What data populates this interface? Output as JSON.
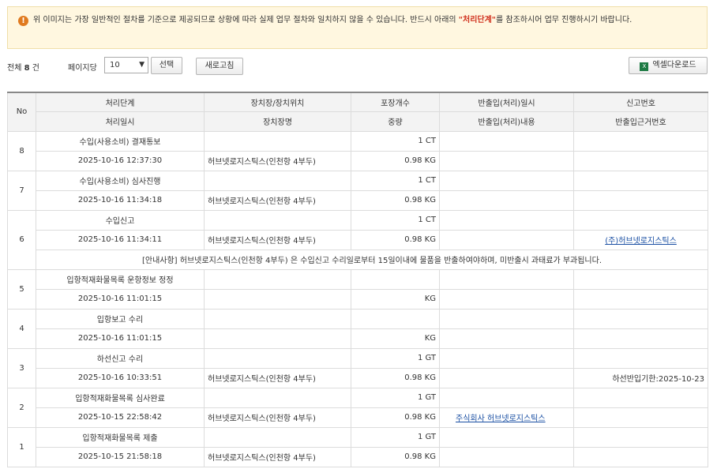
{
  "notice": {
    "icon": "warning-icon",
    "text_before": "위 이미지는 가장 일반적인 절차를 기준으로 제공되므로 상황에 따라 실제 업무 절차와 일치하지 않을 수 있습니다. 반드시 아래의 ",
    "highlight": "\"처리단계\"",
    "text_after": "를 참조하시어 업무 진행하시기 바랍니다."
  },
  "toolbar": {
    "total_prefix": "전체",
    "total_count": "8",
    "total_suffix": "건",
    "perpage_label": "페이지당",
    "perpage_value": "10",
    "select_button": "선택",
    "refresh_button": "새로고침",
    "excel_button": "엑셀다운로드",
    "excel_icon": "excel-icon"
  },
  "table": {
    "headers_top": [
      "No",
      "처리단계",
      "장치장/장치위치",
      "포장개수",
      "반출입(처리)일시",
      "신고번호"
    ],
    "headers_bottom": [
      "처리일시",
      "장치장명",
      "중량",
      "반출입(처리)내용",
      "반출입근거번호"
    ],
    "rows": [
      {
        "no": "8",
        "stage": "수입(사용소비) 결재통보",
        "location": "",
        "packages": "1 CT",
        "io_datetime": "",
        "report_no": "",
        "datetime": "2025-10-16 12:37:30",
        "warehouse": "허브넷로지스틱스(인천항 4부두)",
        "weight": "0.98 KG",
        "io_content": "",
        "basis_no": ""
      },
      {
        "no": "7",
        "stage": "수입(사용소비) 심사진행",
        "location": "",
        "packages": "1 CT",
        "io_datetime": "",
        "report_no": "",
        "datetime": "2025-10-16 11:34:18",
        "warehouse": "허브넷로지스틱스(인천항 4부두)",
        "weight": "0.98 KG",
        "io_content": "",
        "basis_no": ""
      },
      {
        "no": "6",
        "stage": "수입신고",
        "location": "",
        "packages": "1 CT",
        "io_datetime": "",
        "report_no": "",
        "datetime": "2025-10-16 11:34:11",
        "warehouse": "허브넷로지스틱스(인천항 4부두)",
        "weight": "0.98 KG",
        "io_content": "",
        "basis_no": "(주)허브넷로지스틱스",
        "guide": "[안내사항] 허브넷로지스틱스(인천항 4부두) 은 수입신고 수리일로부터 15일이내에 물품을 반출하여야하며, 미반출시 과태료가 부과됩니다."
      },
      {
        "no": "5",
        "stage": "입항적재화물목록 운항정보 정정",
        "location": "",
        "packages": "",
        "io_datetime": "",
        "report_no": "",
        "datetime": "2025-10-16 11:01:15",
        "warehouse": "",
        "weight": "KG",
        "io_content": "",
        "basis_no": ""
      },
      {
        "no": "4",
        "stage": "입항보고 수리",
        "location": "",
        "packages": "",
        "io_datetime": "",
        "report_no": "",
        "datetime": "2025-10-16 11:01:15",
        "warehouse": "",
        "weight": "KG",
        "io_content": "",
        "basis_no": ""
      },
      {
        "no": "3",
        "stage": "하선신고 수리",
        "location": "",
        "packages": "1 GT",
        "io_datetime": "",
        "report_no": "",
        "datetime": "2025-10-16 10:33:51",
        "warehouse": "허브넷로지스틱스(인천항 4부두)",
        "weight": "0.98 KG",
        "io_content": "",
        "basis_no": "하선반입기한:2025-10-23"
      },
      {
        "no": "2",
        "stage": "입항적재화물목록 심사완료",
        "location": "",
        "packages": "1 GT",
        "io_datetime": "",
        "report_no": "",
        "datetime": "2025-10-15 22:58:42",
        "warehouse": "허브넷로지스틱스(인천항 4부두)",
        "weight": "0.98 KG",
        "io_content": "주식회사 허브넷로지스틱스",
        "basis_no": ""
      },
      {
        "no": "1",
        "stage": "입항적재화물목록 제출",
        "location": "",
        "packages": "1 GT",
        "io_datetime": "",
        "report_no": "",
        "datetime": "2025-10-15 21:58:18",
        "warehouse": "허브넷로지스틱스(인천항 4부두)",
        "weight": "0.98 KG",
        "io_content": "",
        "basis_no": ""
      }
    ]
  },
  "colors": {
    "notice_bg": "#fff7e0",
    "highlight": "#d0311e",
    "link": "#1a4fa3"
  }
}
